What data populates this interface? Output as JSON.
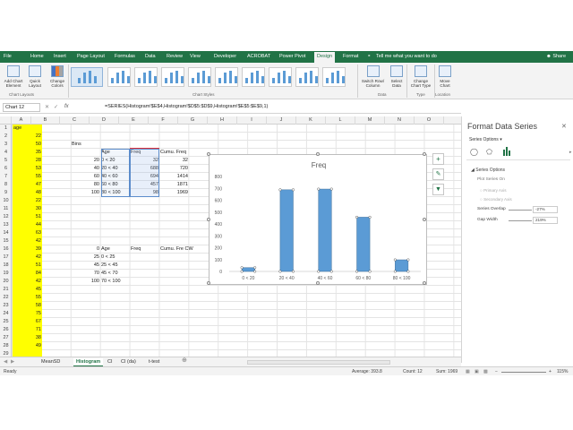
{
  "ribbon_tabs": [
    {
      "label": "File",
      "selected": false
    },
    {
      "label": "Home",
      "selected": false
    },
    {
      "label": "Insert",
      "selected": false
    },
    {
      "label": "Page Layout",
      "selected": false
    },
    {
      "label": "Formulas",
      "selected": false
    },
    {
      "label": "Data",
      "selected": false
    },
    {
      "label": "Review",
      "selected": false
    },
    {
      "label": "View",
      "selected": false
    },
    {
      "label": "Developer",
      "selected": false
    },
    {
      "label": "ACROBAT",
      "selected": false
    },
    {
      "label": "Power Pivot",
      "selected": false
    },
    {
      "label": "Design",
      "selected": true
    },
    {
      "label": "Format",
      "selected": false
    }
  ],
  "tell_me": "Tell me what you want to do",
  "share_label": "Share",
  "ribbon": {
    "add_chart_element": "Add Chart Element",
    "quick_layout": "Quick Layout",
    "change_colors": "Change Colors",
    "switch_row_column": "Switch Row/ Column",
    "select_data": "Select Data",
    "change_chart_type": "Change Chart Type",
    "move_chart": "Move Chart",
    "groups": {
      "chart_layouts": "Chart Layouts",
      "chart_styles": "Chart Styles",
      "data": "Data",
      "type": "Type",
      "location": "Location"
    }
  },
  "name_box": "Chart 12",
  "formula": "=SERIES(Histogram!$E$4,Histogram!$D$5:$D$9,Histogram!$E$5:$E$9,1)",
  "columns": [
    "A",
    "B",
    "C",
    "D",
    "E",
    "F",
    "G",
    "H",
    "I",
    "J",
    "K",
    "L",
    "M",
    "N",
    "O"
  ],
  "rows": [
    "1",
    "2",
    "3",
    "4",
    "5",
    "6",
    "7",
    "8",
    "9",
    "10",
    "11",
    "12",
    "13",
    "14",
    "15",
    "16",
    "17",
    "18",
    "19",
    "20",
    "21",
    "22",
    "23",
    "24",
    "25",
    "26",
    "27",
    "28",
    "29"
  ],
  "age_header": "age",
  "ages": [
    22,
    50,
    35,
    28,
    53,
    55,
    47,
    48,
    22,
    30,
    51,
    44,
    63,
    42,
    39,
    42,
    51,
    84,
    42,
    45,
    55,
    58,
    75,
    67,
    71,
    38,
    49
  ],
  "bins_label": "Bins",
  "table1": {
    "headers": [
      "Age",
      "Freq",
      "Cumu. Freq"
    ],
    "rows": [
      {
        "bin": "20",
        "age": "0 < 20",
        "freq": "32",
        "cumu": "32"
      },
      {
        "bin": "40",
        "age": "20 < 40",
        "freq": "688",
        "cumu": "720"
      },
      {
        "bin": "60",
        "age": "40 < 60",
        "freq": "694",
        "cumu": "1414"
      },
      {
        "bin": "80",
        "age": "60 < 80",
        "freq": "457",
        "cumu": "1871"
      },
      {
        "bin": "100",
        "age": "80 < 100",
        "freq": "98",
        "cumu": "1969"
      }
    ]
  },
  "table2": {
    "headers": [
      "Age",
      "Freq",
      "Cumu. Fre CW"
    ],
    "rows": [
      {
        "bin": "0",
        "age": ""
      },
      {
        "bin": "25",
        "age": "0 < 25"
      },
      {
        "bin": "45",
        "age": "25 < 45"
      },
      {
        "bin": "70",
        "age": "45 < 70"
      },
      {
        "bin": "100",
        "age": "70 < 100"
      }
    ]
  },
  "chart_data": {
    "type": "bar",
    "title": "Freq",
    "categories": [
      "0 < 20",
      "20 < 40",
      "40 < 60",
      "60 < 80",
      "80 < 100"
    ],
    "values": [
      32,
      688,
      694,
      457,
      98
    ],
    "ylim": [
      0,
      800
    ],
    "yticks": [
      0,
      100,
      200,
      300,
      400,
      500,
      600,
      700,
      800
    ],
    "grid": false,
    "color": "#5b9bd5",
    "xlabel": "",
    "ylabel": ""
  },
  "panel": {
    "title": "Format Data Series",
    "series_options_dropdown": "Series Options",
    "section": "Series Options",
    "plot_series_on": "Plot Series On",
    "primary_axis": "Primary Axis",
    "secondary_axis": "Secondary Axis",
    "series_overlap_label": "Series Overlap",
    "series_overlap_value": "-27%",
    "gap_width_label": "Gap Width",
    "gap_width_value": "219%"
  },
  "sheet_tabs": [
    {
      "label": "MeanSD",
      "active": false
    },
    {
      "label": "Histogram",
      "active": true
    },
    {
      "label": "CI",
      "active": false
    },
    {
      "label": "CI (dа)",
      "active": false
    },
    {
      "label": "t-test",
      "active": false
    }
  ],
  "status": {
    "ready": "Ready",
    "average": "Average: 393.8",
    "count": "Count: 12",
    "sum": "Sum: 1969",
    "zoom": "115%"
  },
  "colors": {
    "excel_green": "#217346",
    "age_highlight": "#ffff00",
    "bar_fill": "#5b9bd5"
  }
}
